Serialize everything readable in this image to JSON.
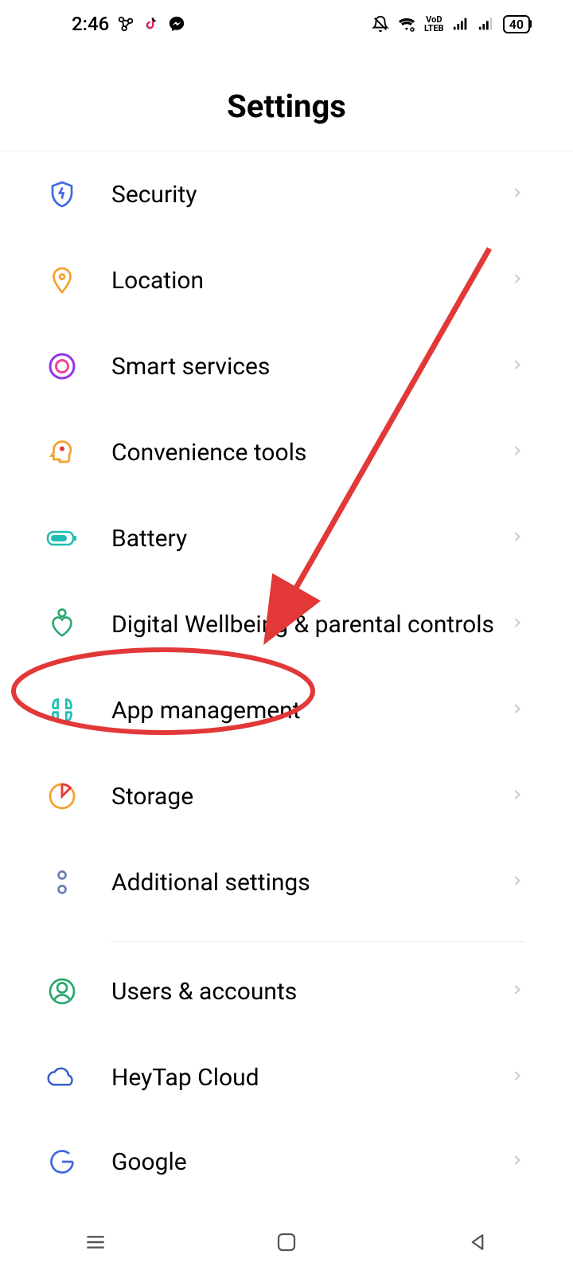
{
  "status_bar": {
    "time": "2:46",
    "battery": "40",
    "network_label": "VoD\nLTEB"
  },
  "header": {
    "title": "Settings"
  },
  "settings": {
    "items": [
      {
        "id": "security",
        "label": "Security",
        "icon": "shield-lightning",
        "color": "#4169E1"
      },
      {
        "id": "location",
        "label": "Location",
        "icon": "map-pin",
        "color": "#F4A02E"
      },
      {
        "id": "smart-services",
        "label": "Smart services",
        "icon": "target-circle",
        "color": "#D946EF"
      },
      {
        "id": "convenience-tools",
        "label": "Convenience tools",
        "icon": "head-profile",
        "color": "#F4A02E"
      },
      {
        "id": "battery",
        "label": "Battery",
        "icon": "battery",
        "color": "#1CBFB0"
      },
      {
        "id": "digital-wellbeing",
        "label": "Digital Wellbeing & parental controls",
        "icon": "heart-person",
        "color": "#2BA86E"
      },
      {
        "id": "app-management",
        "label": "App management",
        "icon": "apps-grid",
        "color": "#1CBFB0"
      },
      {
        "id": "storage",
        "label": "Storage",
        "icon": "pie-chart",
        "color": "#F4A02E"
      },
      {
        "id": "additional-settings",
        "label": "Additional settings",
        "icon": "two-dots",
        "color": "#6B7DB3"
      }
    ],
    "items2": [
      {
        "id": "users-accounts",
        "label": "Users & accounts",
        "icon": "user-circle",
        "color": "#2BA86E"
      },
      {
        "id": "heytap-cloud",
        "label": "HeyTap Cloud",
        "icon": "cloud",
        "color": "#2E5BCC"
      },
      {
        "id": "google",
        "label": "Google",
        "icon": "google-g",
        "color": "#4169E1"
      }
    ]
  },
  "annotation": {
    "highlighted_item": "app-management",
    "color": "#E23838"
  }
}
